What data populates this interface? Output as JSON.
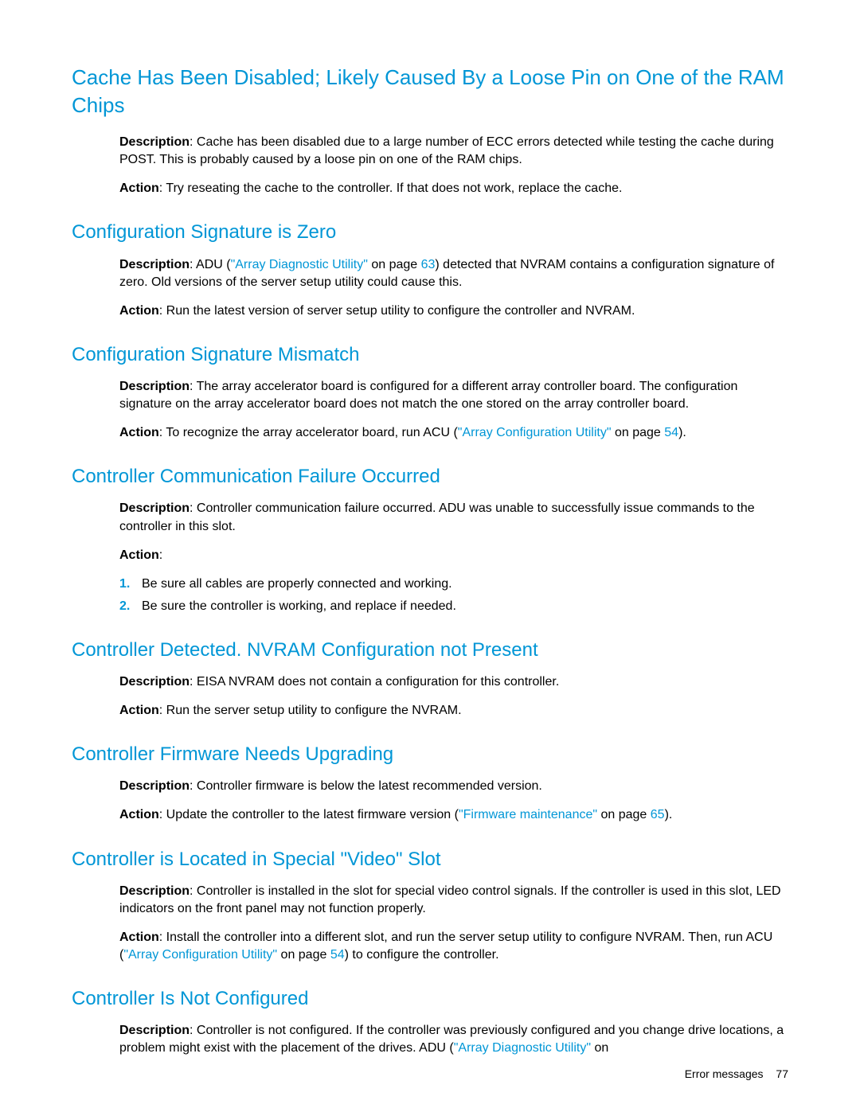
{
  "section1": {
    "heading": "Cache Has Been Disabled; Likely Caused By a Loose Pin on One of the RAM Chips",
    "desc_label": "Description",
    "desc_text": ": Cache has been disabled due to a large number of ECC errors detected while testing the cache during POST. This is probably caused by a loose pin on one of the RAM chips.",
    "action_label": "Action",
    "action_text": ": Try reseating the cache to the controller. If that does not work, replace the cache."
  },
  "section2": {
    "heading": "Configuration Signature is Zero",
    "desc_label": "Description",
    "desc_pre": ": ADU (",
    "link_text": "\"Array Diagnostic Utility\"",
    "desc_mid": " on page ",
    "page_ref": "63",
    "desc_post": ") detected that NVRAM contains a configuration signature of zero. Old versions of the server setup utility could cause this.",
    "action_label": "Action",
    "action_text": ": Run the latest version of server setup utility to configure the controller and NVRAM."
  },
  "section3": {
    "heading": "Configuration Signature Mismatch",
    "desc_label": "Description",
    "desc_text": ": The array accelerator board is configured for a different array controller board. The configuration signature on the array accelerator board does not match the one stored on the array controller board.",
    "action_label": "Action",
    "action_pre": ": To recognize the array accelerator board, run ACU (",
    "link_text": "\"Array Configuration Utility\"",
    "action_mid": " on page ",
    "page_ref": "54",
    "action_post": ")."
  },
  "section4": {
    "heading": "Controller Communication Failure Occurred",
    "desc_label": "Description",
    "desc_text": ": Controller communication failure occurred. ADU was unable to successfully issue commands to the controller in this slot.",
    "action_label": "Action",
    "action_colon": ":",
    "steps": [
      {
        "n": "1.",
        "t": "Be sure all cables are properly connected and working."
      },
      {
        "n": "2.",
        "t": "Be sure the controller is working, and replace if needed."
      }
    ]
  },
  "section5": {
    "heading": "Controller Detected. NVRAM Configuration not Present",
    "desc_label": "Description",
    "desc_text": ": EISA NVRAM does not contain a configuration for this controller.",
    "action_label": "Action",
    "action_text": ": Run the server setup utility to configure the NVRAM."
  },
  "section6": {
    "heading": "Controller Firmware Needs Upgrading",
    "desc_label": "Description",
    "desc_text": ": Controller firmware is below the latest recommended version.",
    "action_label": "Action",
    "action_pre": ": Update the controller to the latest firmware version (",
    "link_text": "\"Firmware maintenance\"",
    "action_mid": " on page ",
    "page_ref": "65",
    "action_post": ")."
  },
  "section7": {
    "heading": "Controller is Located in Special \"Video\" Slot",
    "desc_label": "Description",
    "desc_text": ": Controller is installed in the slot for special video control signals. If the controller is used in this slot, LED indicators on the front panel may not function properly.",
    "action_label": "Action",
    "action_pre": ": Install the controller into a different slot, and run the server setup utility to configure NVRAM. Then, run ACU (",
    "link_text": "\"Array Configuration Utility\"",
    "action_mid": " on page ",
    "page_ref": "54",
    "action_post": ") to configure the controller."
  },
  "section8": {
    "heading": "Controller Is Not Configured",
    "desc_label": "Description",
    "desc_pre": ": Controller is not configured. If the controller was previously configured and you change drive locations, a problem might exist with the placement of the drives. ADU (",
    "link_text": "\"Array Diagnostic Utility\"",
    "desc_post": " on"
  },
  "footer": {
    "label": "Error messages",
    "page": "77"
  }
}
